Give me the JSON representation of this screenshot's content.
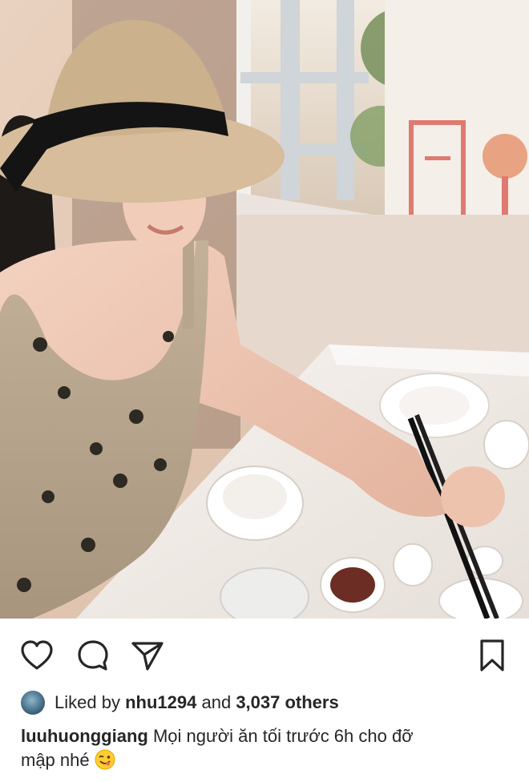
{
  "post": {
    "photo_alt": "",
    "actions": {
      "like": "heart-icon",
      "comment": "comment-icon",
      "share": "send-icon",
      "save": "bookmark-icon"
    },
    "likes": {
      "prefix": "Liked by",
      "user": "nhu1294",
      "middle": "and",
      "others": "3,037 others"
    },
    "caption": {
      "username": "luuhuonggiang",
      "text_line1": "Mọi người ăn tối trước 6h cho đỡ",
      "text_line2": "mập nhé",
      "emoji": "winking-face-with-tongue"
    }
  }
}
